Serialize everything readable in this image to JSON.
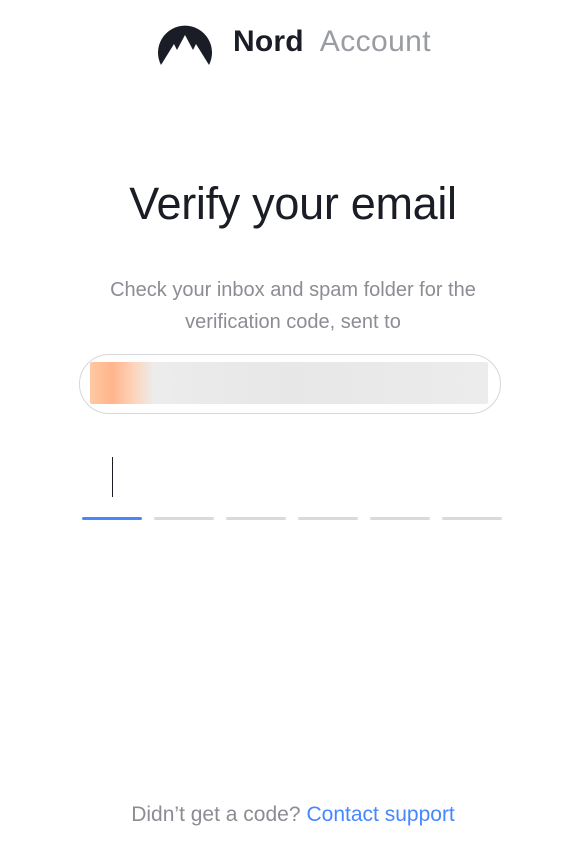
{
  "brand": {
    "name": "Nord",
    "product": "Account",
    "logo_icon": "nord-mountain-logo-icon",
    "logo_color": "#1b1d26"
  },
  "heading": {
    "title": "Verify your email",
    "subtitle": "Check your inbox and spam folder for the verification code, sent to"
  },
  "email": {
    "value": "",
    "redacted": true
  },
  "code": {
    "length": 6,
    "digits": [
      "",
      "",
      "",
      "",
      "",
      ""
    ],
    "active_index": 0
  },
  "footer": {
    "prompt": "Didn’t get a code?",
    "link_label": "Contact support"
  },
  "colors": {
    "text": "#1b1d26",
    "muted": "#8b8d94",
    "accent": "#4687ff",
    "underline": "#d9dadd"
  }
}
